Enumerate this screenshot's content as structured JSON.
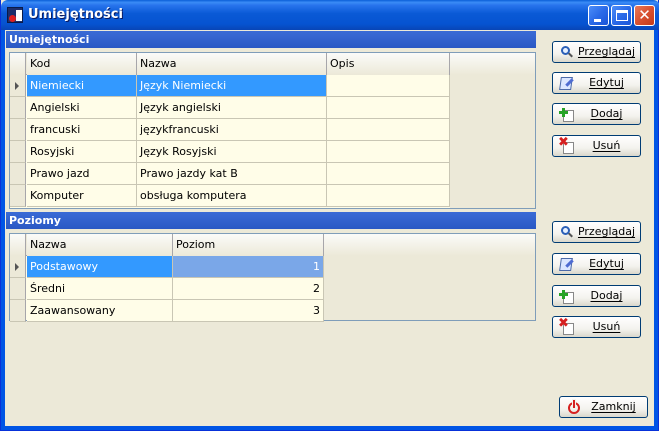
{
  "window": {
    "title": "Umiejętności"
  },
  "skills": {
    "header": "Umiejętności",
    "columns": [
      "Kod",
      "Nazwa",
      "Opis"
    ],
    "rows": [
      {
        "kod": "Niemiecki",
        "nazwa": "Język Niemiecki",
        "opis": ""
      },
      {
        "kod": "Angielski",
        "nazwa": "Język angielski",
        "opis": ""
      },
      {
        "kod": "francuski",
        "nazwa": "językfrancuski",
        "opis": ""
      },
      {
        "kod": "Rosyjski",
        "nazwa": "Język Rosyjski",
        "opis": ""
      },
      {
        "kod": "Prawo jazd",
        "nazwa": "Prawo jazdy kat B",
        "opis": ""
      },
      {
        "kod": "Komputer",
        "nazwa": "obsługa komputera",
        "opis": ""
      }
    ],
    "buttons": {
      "view": "Przeglądaj",
      "edit": "Edytuj",
      "add": "Dodaj",
      "delete": "Usuń"
    }
  },
  "levels": {
    "header": "Poziomy",
    "columns": [
      "Nazwa",
      "Poziom"
    ],
    "rows": [
      {
        "nazwa": "Podstawowy",
        "poziom": "1"
      },
      {
        "nazwa": "Średni",
        "poziom": "2"
      },
      {
        "nazwa": "Zaawansowany",
        "poziom": "3"
      }
    ],
    "buttons": {
      "view": "Przeglądaj",
      "edit": "Edytuj",
      "add": "Dodaj",
      "delete": "Usuń"
    }
  },
  "footer": {
    "close_label": "Zamknij"
  },
  "colors": {
    "titlebar": "#0a5ad6",
    "panel_header": "#2a58c4",
    "selection": "#3399ff",
    "grid_background": "#fffde8"
  },
  "icons": {
    "app": "app-icon",
    "view": "magnifier-icon",
    "edit": "edit-document-icon",
    "add": "add-document-icon",
    "delete": "delete-document-icon",
    "close": "power-icon"
  }
}
